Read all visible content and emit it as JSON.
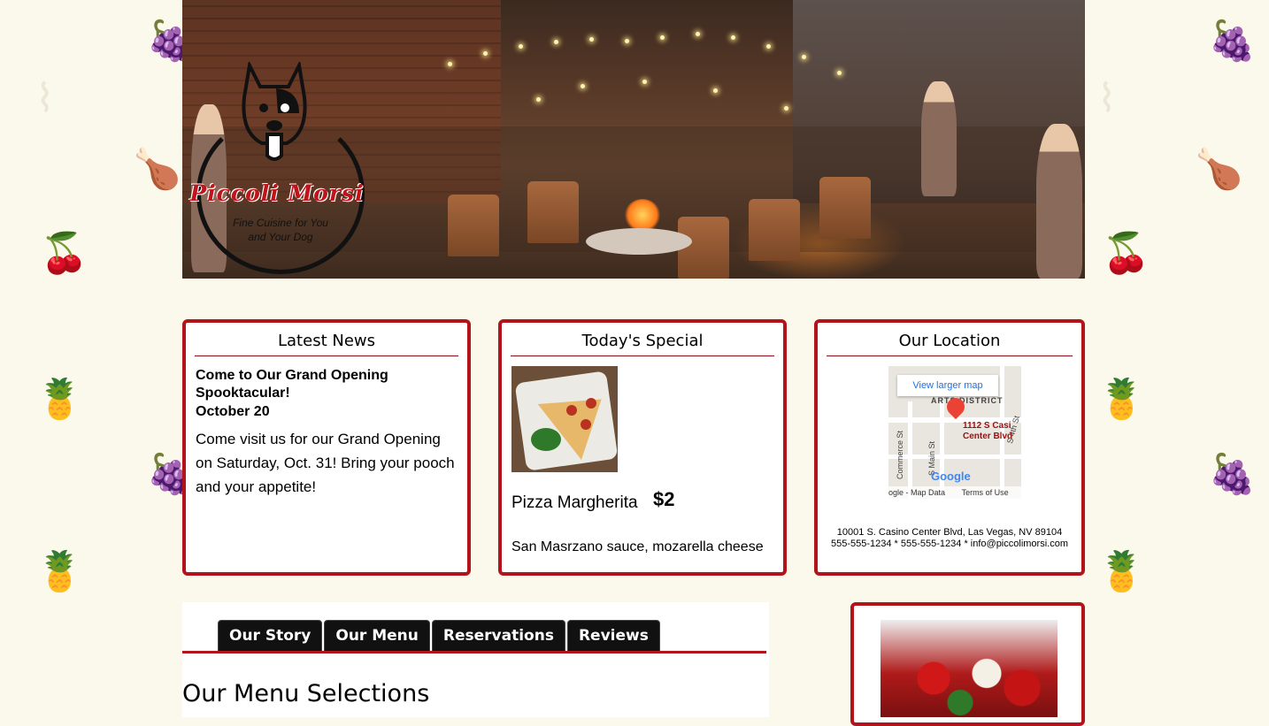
{
  "brand": {
    "name": "Piccoli Morsi",
    "tagline_1": "Fine Cuisine for You",
    "tagline_2": "and Your Dog"
  },
  "news": {
    "heading": "Latest News",
    "title": "Come to Our Grand Opening Spooktacular!",
    "date": "October 20",
    "body": "Come visit us for our Grand Opening on Saturday, Oct. 31! Bring your pooch and your appetite!"
  },
  "special": {
    "heading": "Today's Special",
    "name": "Pizza Margherita",
    "price": "$2",
    "description": "San Masrzano sauce, mozarella cheese"
  },
  "location": {
    "heading": "Our Location",
    "map": {
      "view_larger": "View larger map",
      "district": "ARTS DISTRICT",
      "pin_label_1": "1112 S Casi",
      "pin_label_2": "Center Blvd",
      "street_1": "Commerce St",
      "street_2": "S Main St",
      "street_3": "S 4th St",
      "google": "Google",
      "footer_data": "ogle - Map Data",
      "footer_terms": "Terms of Use"
    },
    "address": "10001 S. Casino Center Blvd, Las Vegas, NV 89104",
    "contact": "555-555-1234 * 555-555-1234 * info@piccolimorsi.com"
  },
  "tabs": [
    "Our Story",
    "Our Menu",
    "Reservations",
    "Reviews"
  ],
  "section_title": "Our Menu Selections",
  "colors": {
    "background": "#fbf8ec",
    "accent": "#b3141b",
    "tab": "#111111"
  }
}
